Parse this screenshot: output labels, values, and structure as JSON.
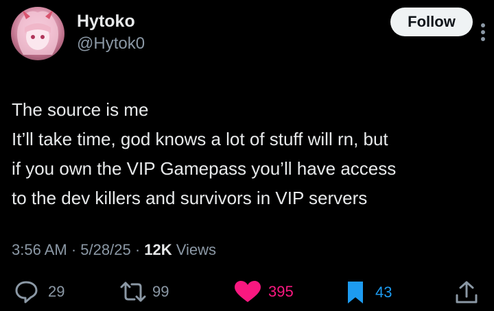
{
  "author": {
    "name": "Hytoko",
    "handle": "@Hytok0"
  },
  "follow_label": "Follow",
  "tweet_lines": [
    "The source is me",
    "It’ll take time, god knows a lot of stuff will rn, but",
    "if you own the VIP Gamepass you’ll have access",
    "to the dev killers and survivors in VIP servers"
  ],
  "meta": {
    "time": "3:56 AM",
    "date": "5/28/25",
    "views_count": "12K",
    "views_label": "Views",
    "separator": "·"
  },
  "actions": {
    "replies": "29",
    "reposts": "99",
    "likes": "395",
    "bookmarks": "43"
  },
  "icons": {
    "reply": "comment-icon",
    "repost": "repost-icon",
    "like": "heart-icon",
    "bookmark": "bookmark-icon",
    "share": "share-icon",
    "more": "more-icon"
  },
  "colors": {
    "background": "#000000",
    "text": "#e7e9ea",
    "muted": "#8b98a5",
    "like": "#f91880",
    "bookmark": "#1d9bf0"
  }
}
